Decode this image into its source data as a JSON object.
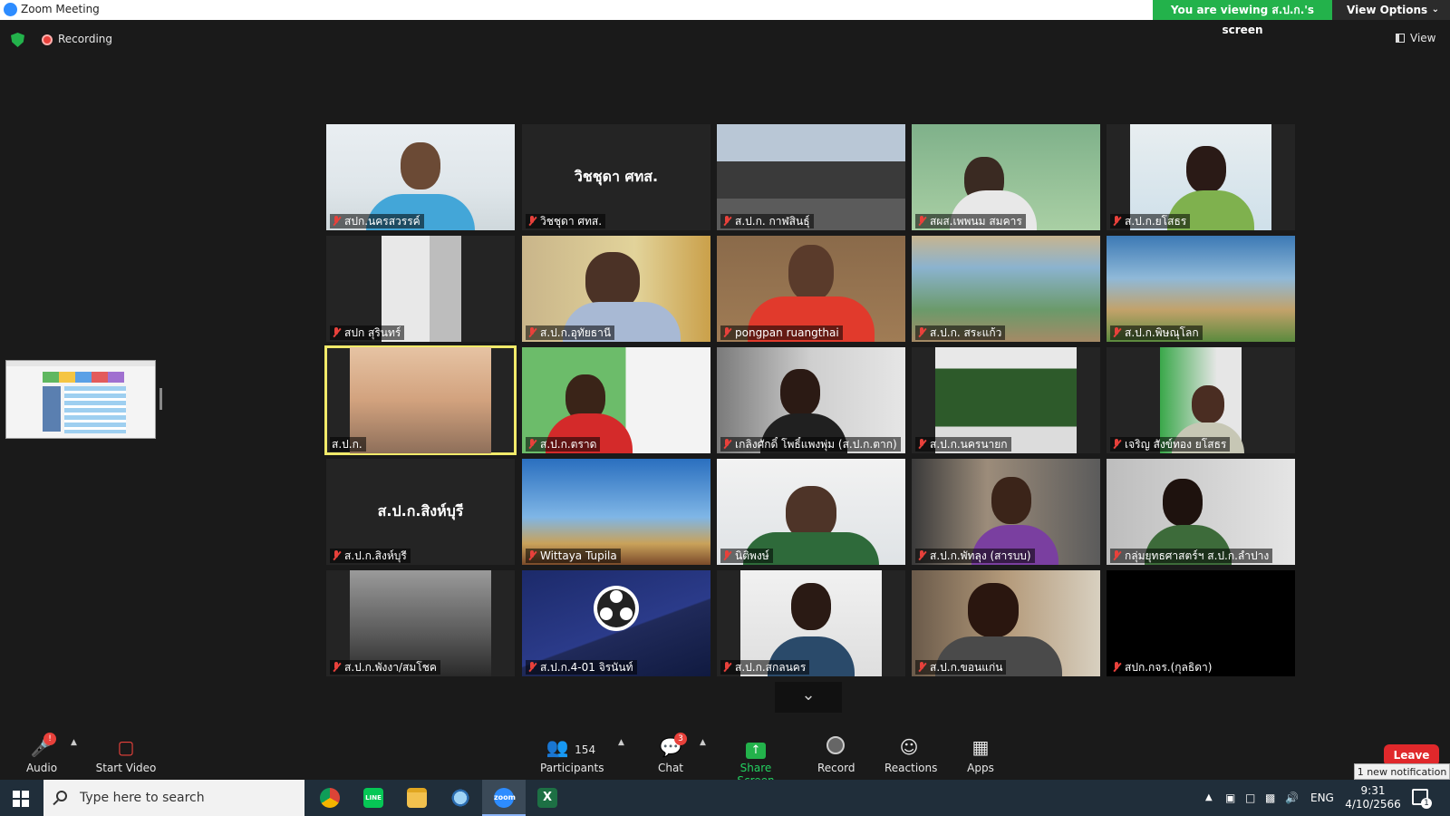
{
  "window": {
    "title": "Zoom Meeting",
    "viewing_banner": "You are viewing ส.ป.ก.'s screen",
    "view_options": "View Options",
    "view_options_chevron": "⌄"
  },
  "topbar": {
    "recording": "Recording",
    "view": "View"
  },
  "tiles": [
    {
      "label": "สปก.นครสวรรค์"
    },
    {
      "label": "วิชชุดา ศทส.",
      "display_name": "วิชชุดา ศทส."
    },
    {
      "label": "ส.ป.ก. กาฬสินธุ์"
    },
    {
      "label": "สผส.เพพนม สมคาร"
    },
    {
      "label": "ส.ป.ก.ยโสธร"
    },
    {
      "label": "สปก สุรินทร์"
    },
    {
      "label": "ส.ป.ก.อุทัยธานี"
    },
    {
      "label": "pongpan ruangthai"
    },
    {
      "label": "ส.ป.ก. สระแก้ว"
    },
    {
      "label": "ส.ป.ก.พิษณุโลก"
    },
    {
      "label": "ส.ป.ก."
    },
    {
      "label": "ส.ป.ก.ตราด"
    },
    {
      "label": "เกลิงศักดิ์ โพธิ์แพงพุ่ม (ส.ป.ก.ตาก)"
    },
    {
      "label": "ส.ป.ก.นครนายก"
    },
    {
      "label": "เจริญ สังข์ทอง ยโสธร"
    },
    {
      "label": "ส.ป.ก.สิงห์บุรี",
      "display_name": "ส.ป.ก.สิงห์บุรี"
    },
    {
      "label": "Wittaya Tupila"
    },
    {
      "label": "นิติพงษ์"
    },
    {
      "label": "ส.ป.ก.พัทลุง (สารบบ)"
    },
    {
      "label": "กลุ่มยุทธศาสตร์ฯ ส.ป.ก.ลำปาง"
    },
    {
      "label": "ส.ป.ก.พังงา/สมโชค"
    },
    {
      "label": "ส.ป.ก.4-01 จิรนันท์"
    },
    {
      "label": "ส.ป.ก.สกลนคร"
    },
    {
      "label": "ส.ป.ก.ขอนแก่น"
    },
    {
      "label": "สปก.กจร.(กุลธิดา)"
    }
  ],
  "toolbar": {
    "audio": "Audio",
    "audio_badge": "!",
    "start_video": "Start Video",
    "participants": "Participants",
    "participants_count": "154",
    "chat": "Chat",
    "chat_badge": "3",
    "share_screen": "Share Screen",
    "record": "Record",
    "reactions": "Reactions",
    "apps": "Apps",
    "leave": "Leave",
    "notification": "1 new notification"
  },
  "taskbar": {
    "search_placeholder": "Type here to search",
    "apps": [
      "chrome",
      "line",
      "file-explorer",
      "search-app",
      "zoom",
      "excel"
    ],
    "zoom_label": "zoom",
    "line_label": "LINE",
    "excel_label": "X",
    "language": "ENG",
    "time": "9:31",
    "date": "4/10/2566",
    "notifications_count": "1"
  }
}
